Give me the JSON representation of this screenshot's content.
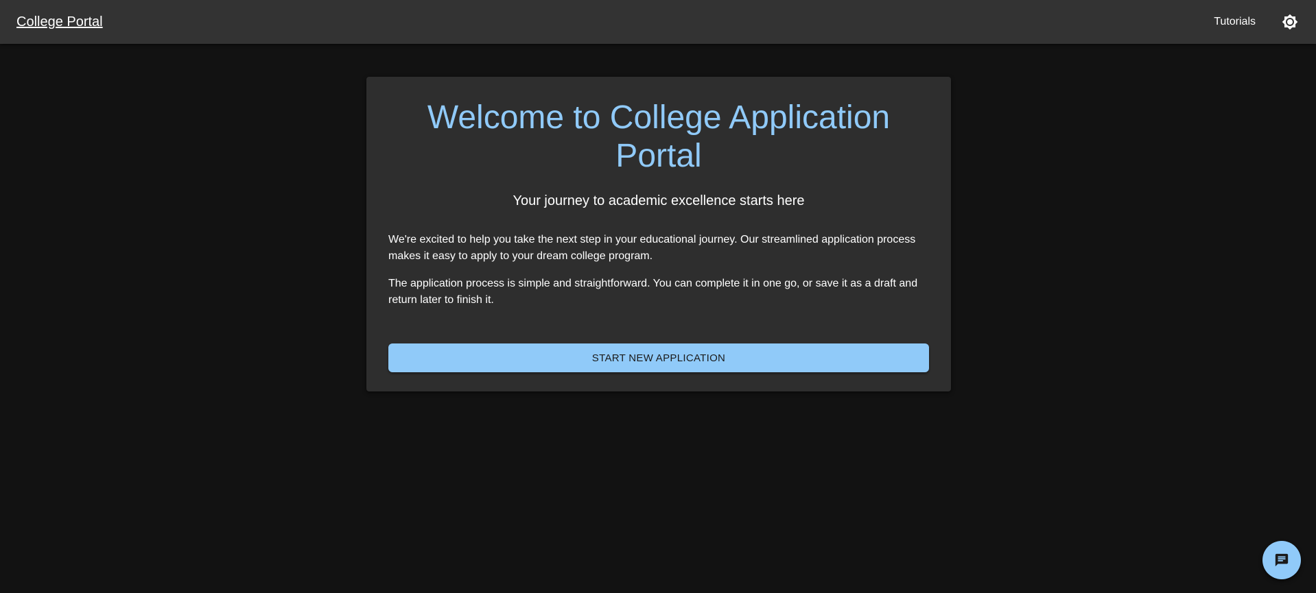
{
  "header": {
    "brand": "College Portal",
    "nav": [
      {
        "label": "Tutorials"
      }
    ],
    "theme_toggle_icon": "brightness-gear-icon"
  },
  "welcome": {
    "title": "Welcome to College Application Portal",
    "subtitle": "Your journey to academic excellence starts here",
    "paragraphs": [
      "We're excited to help you take the next step in your educational journey. Our streamlined application process makes it easy to apply to your dream college program.",
      "The application process is simple and straightforward. You can complete it in one go, or save it as a draft and return later to finish it."
    ],
    "cta_label": "START NEW APPLICATION"
  },
  "chat": {
    "icon": "chat-icon"
  },
  "colors": {
    "background": "#121212",
    "appbar": "#333333",
    "card": "#2e2e2e",
    "accent": "#90caf9"
  }
}
